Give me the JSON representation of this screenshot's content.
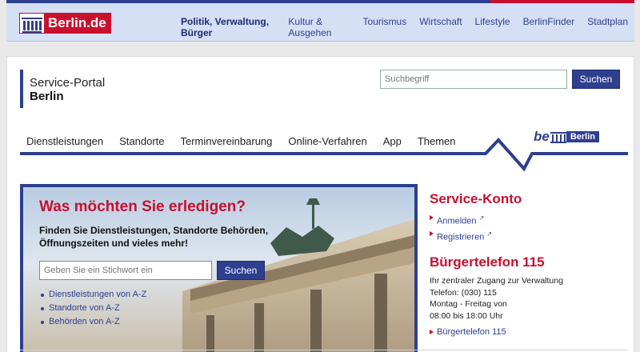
{
  "topbar": {
    "logo_text": "Berlin.de",
    "nav": [
      {
        "label": "Politik, Verwaltung, Bürger"
      },
      {
        "label": "Kultur & Ausgehen"
      },
      {
        "label": "Tourismus"
      },
      {
        "label": "Wirtschaft"
      },
      {
        "label": "Lifestyle"
      },
      {
        "label": "BerlinFinder"
      },
      {
        "label": "Stadtplan"
      }
    ]
  },
  "brand": {
    "line1": "Service-Portal",
    "line2": "Berlin"
  },
  "search": {
    "placeholder": "Suchbegriff",
    "button": "Suchen"
  },
  "mainnav": [
    {
      "label": "Dienstleistungen"
    },
    {
      "label": "Standorte"
    },
    {
      "label": "Terminvereinbarung"
    },
    {
      "label": "Online-Verfahren"
    },
    {
      "label": "App"
    },
    {
      "label": "Themen"
    }
  ],
  "be_logo": {
    "be": "be",
    "berlin": "Berlin"
  },
  "hero": {
    "title": "Was möchten Sie erledigen?",
    "text": "Finden Sie Dienstleistungen, Standorte Behörden, Öffnungszeiten und vieles mehr!",
    "input_placeholder": "Geben Sie ein Stichwort ein",
    "button": "Suchen",
    "links": [
      {
        "label": "Dienstleistungen von A-Z"
      },
      {
        "label": "Standorte von A-Z"
      },
      {
        "label": "Behörden von A-Z"
      }
    ]
  },
  "service_konto": {
    "title": "Service-Konto",
    "links": [
      {
        "label": "Anmelden"
      },
      {
        "label": "Registrieren"
      }
    ]
  },
  "buergertelefon": {
    "title": "Bürgertelefon 115",
    "lines": [
      "Ihr zentraler Zugang zur Verwaltung",
      "Telefon: (030) 115",
      "Montag - Freitag von",
      "08:00 bis 18:00 Uhr"
    ],
    "link": "Bürgertelefon 115"
  },
  "colors": {
    "brand_blue": "#2e3f8f",
    "brand_red": "#c8102e"
  }
}
